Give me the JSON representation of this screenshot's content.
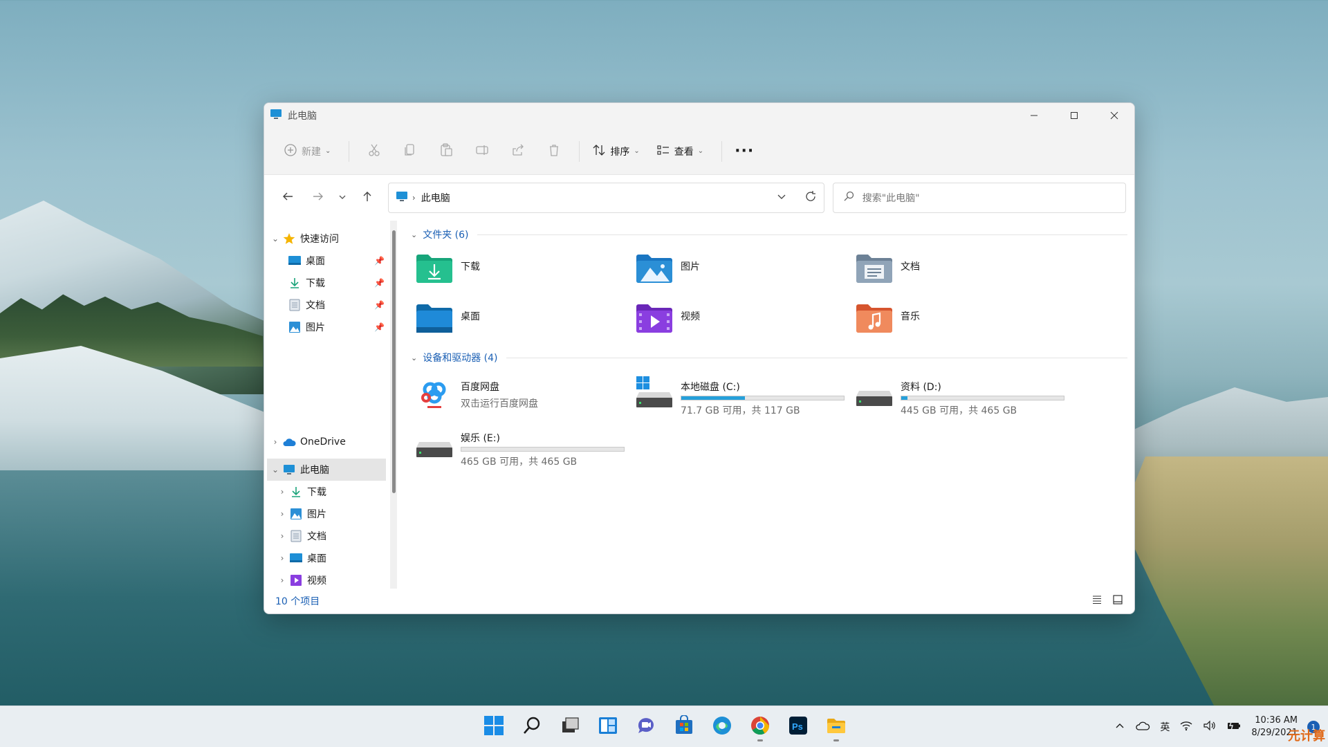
{
  "window": {
    "title": "此电脑",
    "controls": [
      "minimize",
      "maximize",
      "close"
    ]
  },
  "toolbar": {
    "new_label": "新建",
    "sort_label": "排序",
    "view_label": "查看",
    "more_label": "···",
    "icons": [
      "cut-icon",
      "copy-icon",
      "paste-icon",
      "rename-icon",
      "share-icon",
      "delete-icon"
    ]
  },
  "address": {
    "crumb": "此电脑",
    "search_placeholder": "搜索\"此电脑\""
  },
  "sidebar": {
    "quick_access": "快速访问",
    "quick_items": [
      {
        "label": "桌面",
        "icon": "desktop-icon"
      },
      {
        "label": "下载",
        "icon": "download-icon"
      },
      {
        "label": "文档",
        "icon": "documents-icon"
      },
      {
        "label": "图片",
        "icon": "pictures-icon"
      }
    ],
    "onedrive": "OneDrive",
    "this_pc": "此电脑",
    "pc_items": [
      {
        "label": "下载",
        "icon": "download-icon"
      },
      {
        "label": "图片",
        "icon": "pictures-icon"
      },
      {
        "label": "文档",
        "icon": "documents-icon"
      },
      {
        "label": "桌面",
        "icon": "desktop-icon"
      },
      {
        "label": "视频",
        "icon": "videos-icon"
      }
    ]
  },
  "content": {
    "folders_header": "文件夹 (6)",
    "folders": [
      {
        "label": "下载",
        "color": "#1aa37a"
      },
      {
        "label": "图片",
        "color": "#2b8fd6"
      },
      {
        "label": "文档",
        "color": "#7f93a8"
      },
      {
        "label": "桌面",
        "color": "#1f8ad8"
      },
      {
        "label": "视频",
        "color": "#8a3ee0"
      },
      {
        "label": "音乐",
        "color": "#e8734a"
      }
    ],
    "drives_header": "设备和驱动器 (4)",
    "baidu": {
      "name": "百度网盘",
      "sub": "双击运行百度网盘"
    },
    "drives": [
      {
        "name": "本地磁盘 (C:)",
        "sub": "71.7 GB 可用，共 117 GB",
        "used_fraction": 0.39,
        "system": true
      },
      {
        "name": "资料 (D:)",
        "sub": "445 GB 可用，共 465 GB",
        "used_fraction": 0.04,
        "system": false
      },
      {
        "name": "娱乐 (E:)",
        "sub": "465 GB 可用，共 465 GB",
        "used_fraction": 0.0,
        "system": false
      }
    ]
  },
  "status": {
    "count": "10 个项目"
  },
  "taskbar": {
    "apps": [
      "start-icon",
      "search-icon",
      "task-view-icon",
      "widgets-icon",
      "chat-icon",
      "store-icon",
      "edge-icon",
      "chrome-icon",
      "photoshop-icon",
      "file-explorer-icon"
    ],
    "ime": "英",
    "time": "10:36 AM",
    "date": "8/29/2021"
  },
  "watermark": "元计算"
}
